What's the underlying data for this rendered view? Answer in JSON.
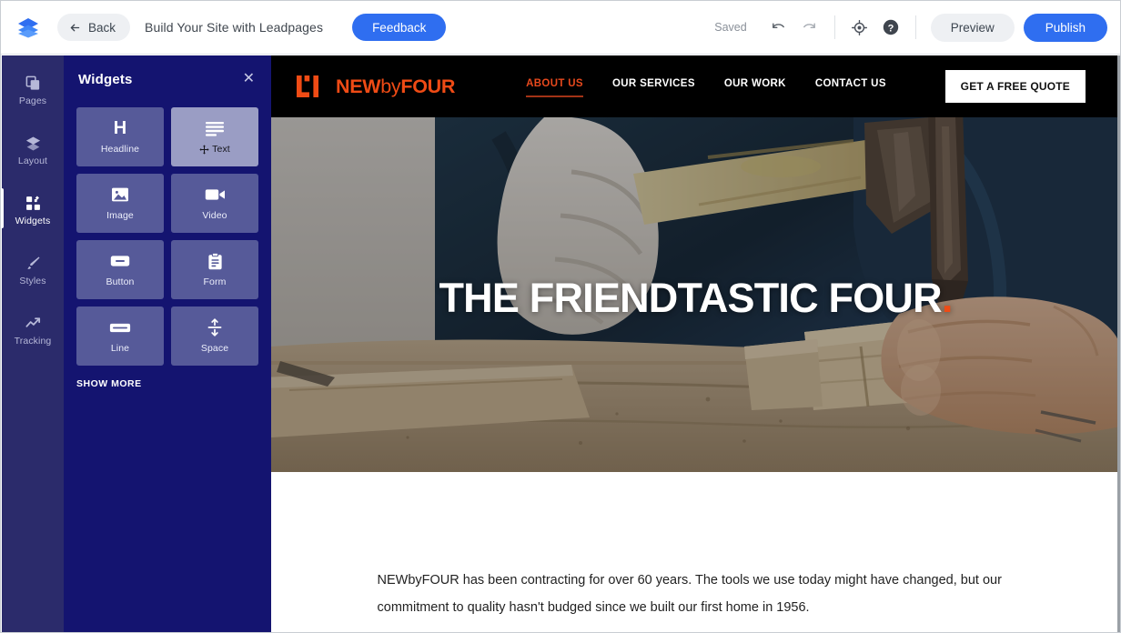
{
  "topbar": {
    "logo_icon": "leadpages-layers-logo",
    "back_label": "Back",
    "back_icon": "arrow-left-icon",
    "document_title": "Build Your Site with Leadpages",
    "feedback_label": "Feedback",
    "saved_label": "Saved",
    "undo_icon": "undo-icon",
    "redo_icon": "redo-icon",
    "target_icon": "target-icon",
    "help_icon": "help-circle-icon",
    "preview_label": "Preview",
    "publish_label": "Publish",
    "accent_blue": "#2f6ef0",
    "pill_grey": "#eef0f3"
  },
  "rail": {
    "background": "#2b2b6b",
    "items": [
      {
        "label": "Pages",
        "icon": "pages-icon",
        "active": false
      },
      {
        "label": "Layout",
        "icon": "layers-icon",
        "active": false
      },
      {
        "label": "Widgets",
        "icon": "widgets-grid-icon",
        "active": true
      },
      {
        "label": "Styles",
        "icon": "paintbrush-icon",
        "active": false
      },
      {
        "label": "Tracking",
        "icon": "trending-up-icon",
        "active": false
      }
    ]
  },
  "panel": {
    "background": "#141470",
    "title": "Widgets",
    "close_icon": "close-icon",
    "show_more_label": "SHOW MORE",
    "widgets": [
      {
        "label": "Headline",
        "icon": "headline-h-icon",
        "hovered": false
      },
      {
        "label": "Text",
        "icon": "text-lines-icon",
        "hovered": true,
        "cursor_icon": "move-cursor-icon"
      },
      {
        "label": "Image",
        "icon": "image-icon",
        "hovered": false
      },
      {
        "label": "Video",
        "icon": "video-camera-icon",
        "hovered": false
      },
      {
        "label": "Button",
        "icon": "button-icon",
        "hovered": false
      },
      {
        "label": "Form",
        "icon": "clipboard-form-icon",
        "hovered": false
      },
      {
        "label": "Line",
        "icon": "horizontal-line-icon",
        "hovered": false
      },
      {
        "label": "Space",
        "icon": "vertical-space-icon",
        "hovered": false
      }
    ]
  },
  "site": {
    "nav": {
      "background": "#000000",
      "brand_mark_icon": "newbyfour-logo-mark",
      "brand_part1": "NEW",
      "brand_part2": "by",
      "brand_part3": "FOUR",
      "brand_color": "#ef4b15",
      "links": [
        {
          "label": "ABOUT US",
          "active": true
        },
        {
          "label": "OUR SERVICES",
          "active": false
        },
        {
          "label": "OUR WORK",
          "active": false
        },
        {
          "label": "CONTACT US",
          "active": false
        }
      ],
      "cta_label": "GET A FREE QUOTE"
    },
    "hero": {
      "headline": "THE FRIENDTASTIC FOUR",
      "headline_dot": ".",
      "dot_color": "#ef4b15",
      "image_description": "carpenter-hands-hatchet-wood"
    },
    "content": {
      "paragraph": "NEWbyFOUR has been contracting for over 60 years. The tools we use today might have changed, but our commitment to quality hasn't budged since we built our first home in 1956."
    }
  }
}
